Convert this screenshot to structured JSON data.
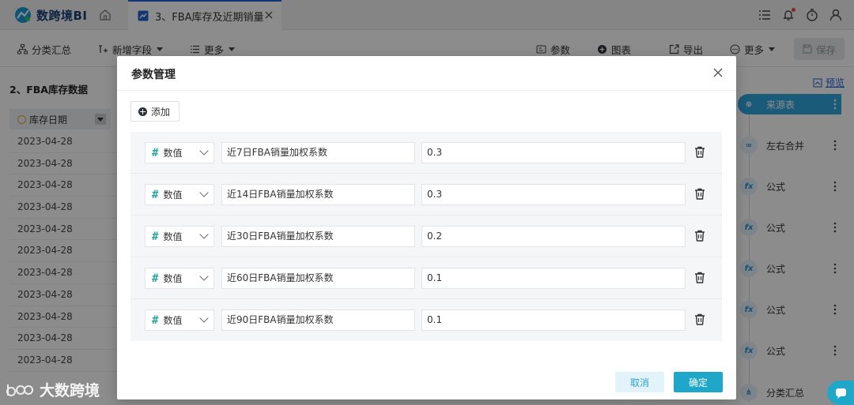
{
  "header": {
    "app_name": "数跨境BI",
    "tab_label": "3、FBA库存及近期销量"
  },
  "toolbar": {
    "group_summary": "分类汇总",
    "add_field": "新增字段",
    "more_left": "更多",
    "params": "参数",
    "chart": "图表",
    "export": "导出",
    "more_right": "更多",
    "save": "保存"
  },
  "left_table": {
    "title": "2、FBA库存数据",
    "column_header": "库存日期",
    "rows": [
      "2023-04-28",
      "2023-04-28",
      "2023-04-28",
      "2023-04-28",
      "2023-04-28",
      "2023-04-28",
      "2023-04-28",
      "2023-04-28",
      "2023-04-28",
      "2023-04-28",
      "2023-04-28"
    ]
  },
  "right_panel": {
    "preview": "预览",
    "nodes": [
      {
        "label": "来源表",
        "icon": "source-icon"
      },
      {
        "label": "左右合并",
        "icon": "merge-icon"
      },
      {
        "label": "公式",
        "icon": "fx-icon"
      },
      {
        "label": "公式",
        "icon": "fx-icon"
      },
      {
        "label": "公式",
        "icon": "fx-icon"
      },
      {
        "label": "公式",
        "icon": "fx-icon"
      },
      {
        "label": "公式",
        "icon": "fx-icon"
      },
      {
        "label": "分类汇总",
        "icon": "summary-icon"
      }
    ]
  },
  "modal": {
    "title": "参数管理",
    "add_label": "添加",
    "params": [
      {
        "type": "数值",
        "name": "近7日FBA销量加权系数",
        "value": "0.3"
      },
      {
        "type": "数值",
        "name": "近14日FBA销量加权系数",
        "value": "0.3"
      },
      {
        "type": "数值",
        "name": "近30日FBA销量加权系数",
        "value": "0.2"
      },
      {
        "type": "数值",
        "name": "近60日FBA销量加权系数",
        "value": "0.1"
      },
      {
        "type": "数值",
        "name": "近90日FBA销量加权系数",
        "value": "0.1"
      }
    ],
    "cancel": "取消",
    "confirm": "确定"
  },
  "watermark": {
    "text": "大数跨境"
  },
  "colors": {
    "accent": "#1ea7c9",
    "tab_accent": "#1f63d6",
    "hash": "#2ba5a0"
  }
}
